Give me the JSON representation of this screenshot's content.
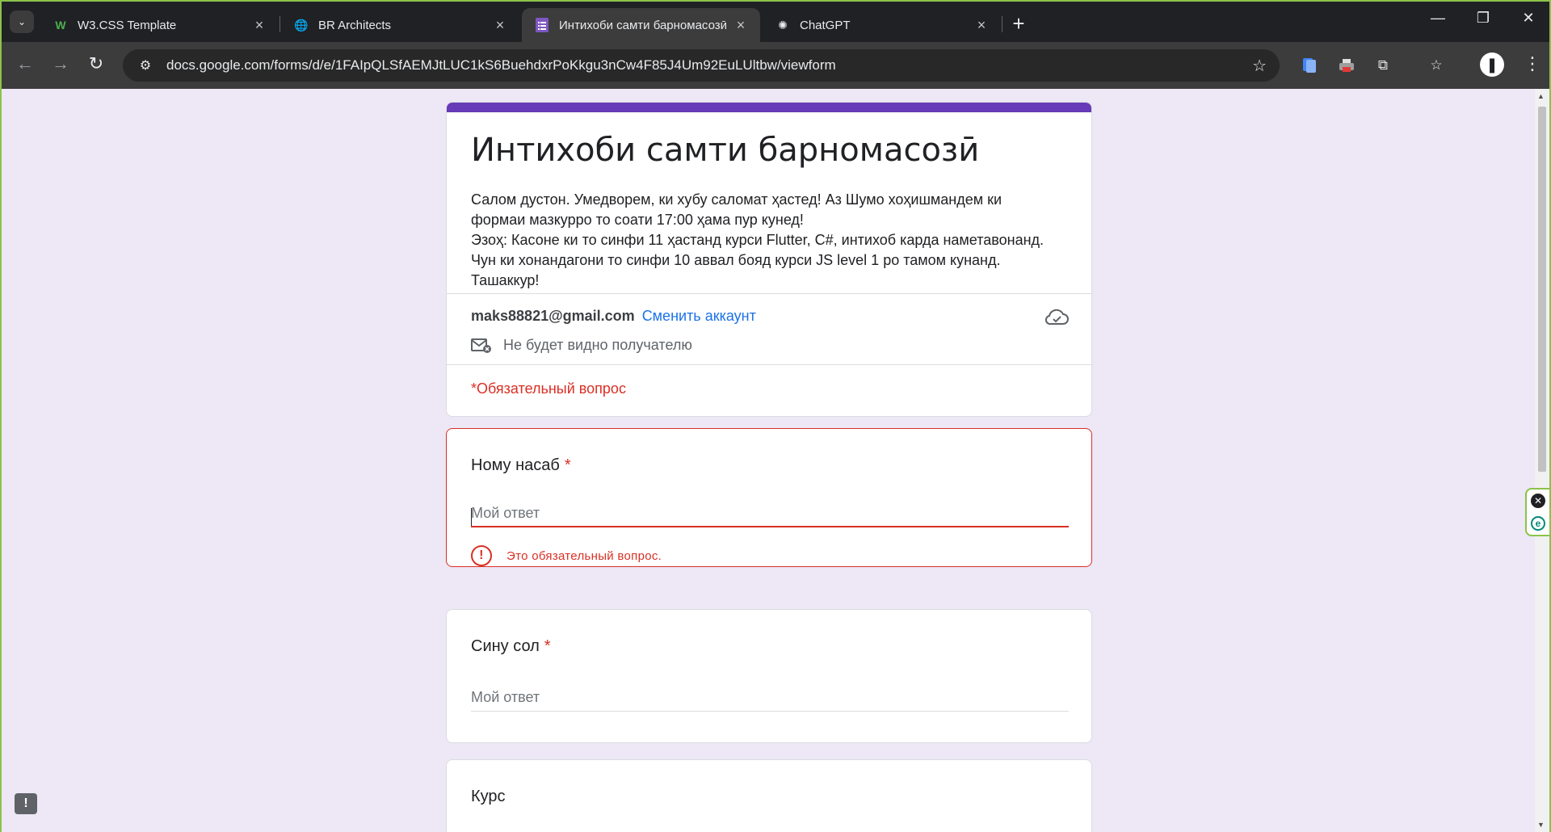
{
  "browser": {
    "tabs": [
      {
        "title": "W3.CSS Template",
        "icon": "w3-icon",
        "active": false
      },
      {
        "title": "BR Architects",
        "icon": "globe-icon",
        "active": false
      },
      {
        "title": "Интихоби самти барномасозӣ",
        "icon": "forms-icon",
        "active": true
      },
      {
        "title": "ChatGPT",
        "icon": "chatgpt-icon",
        "active": false
      }
    ],
    "url": "docs.google.com/forms/d/e/1FAIpQLSfAEMJtLUC1kS6BuehdxrPoKkgu3nCw4F85J4Um92EuLUltbw/viewform"
  },
  "form": {
    "title": "Интихоби самти барномасозӣ",
    "description": "Салом дустон. Умедворем, ки хубу саломат ҳастед! Аз Шумо хоҳишмандем ки\nформаи мазкурро то соати 17:00 ҳама пур кунед!\nЭзоҳ: Касоне ки то синфи 11 ҳастанд курси Flutter, C#, интихоб карда наметавонанд.\nЧун ки хонандагони то синфи 10  аввал бояд курси JS level 1 ро тамом кунанд.\nТашаккур!",
    "account_email": "maks88821@gmail.com",
    "switch_account": "Сменить аккаунт",
    "not_shown": "Не будет видно получателю",
    "required_note": "*Обязательный вопрос"
  },
  "questions": [
    {
      "title": "Ному насаб",
      "required_mark": "*",
      "placeholder": "Мой ответ",
      "error": "Это обязательный вопрос."
    },
    {
      "title": "Сину сол",
      "required_mark": "*",
      "placeholder": "Мой ответ"
    },
    {
      "title": "Курс"
    }
  ],
  "colors": {
    "accent": "#673ab7",
    "error": "#d93025",
    "link": "#1a73e8",
    "page_bg": "#ede7f6"
  }
}
